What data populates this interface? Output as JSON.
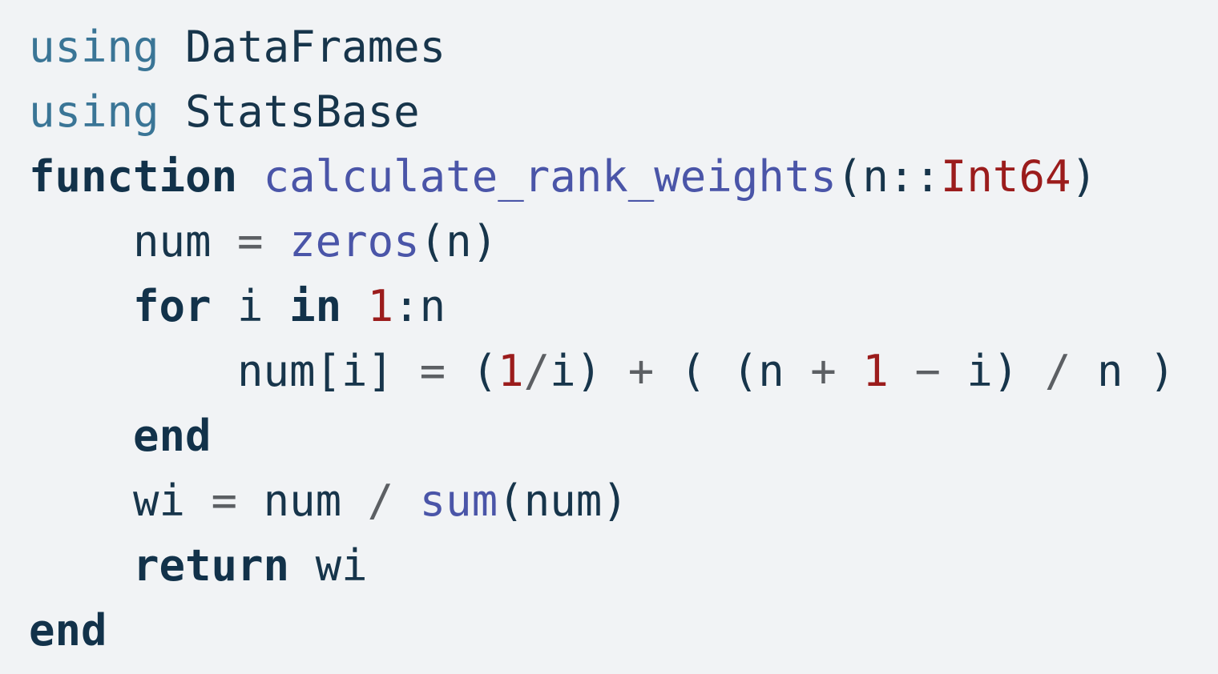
{
  "code": {
    "lines": [
      {
        "tokens": [
          {
            "t": "using",
            "c": "kw-light"
          },
          {
            "t": " "
          },
          {
            "t": "DataFrames"
          }
        ]
      },
      {
        "tokens": [
          {
            "t": "using",
            "c": "kw-light"
          },
          {
            "t": " "
          },
          {
            "t": "StatsBase"
          }
        ]
      },
      {
        "tokens": [
          {
            "t": "function",
            "c": "kw"
          },
          {
            "t": " "
          },
          {
            "t": "calculate_rank_weights",
            "c": "fn"
          },
          {
            "t": "(n::"
          },
          {
            "t": "Int64",
            "c": "type"
          },
          {
            "t": ")"
          }
        ]
      },
      {
        "indent": 1,
        "tokens": [
          {
            "t": "num "
          },
          {
            "t": "=",
            "c": "op"
          },
          {
            "t": " "
          },
          {
            "t": "zeros",
            "c": "fn"
          },
          {
            "t": "(n)"
          }
        ]
      },
      {
        "indent": 1,
        "tokens": [
          {
            "t": "for",
            "c": "kw"
          },
          {
            "t": " i "
          },
          {
            "t": "in",
            "c": "kw"
          },
          {
            "t": " "
          },
          {
            "t": "1",
            "c": "num"
          },
          {
            "t": ":n"
          }
        ]
      },
      {
        "indent": 2,
        "tokens": [
          {
            "t": "num[i] "
          },
          {
            "t": "=",
            "c": "op"
          },
          {
            "t": " ("
          },
          {
            "t": "1",
            "c": "num"
          },
          {
            "t": "/",
            "c": "op"
          },
          {
            "t": "i) "
          },
          {
            "t": "+",
            "c": "op"
          },
          {
            "t": " ( (n "
          },
          {
            "t": "+",
            "c": "op"
          },
          {
            "t": " "
          },
          {
            "t": "1",
            "c": "num"
          },
          {
            "t": " "
          },
          {
            "t": "−",
            "c": "op"
          },
          {
            "t": " i) "
          },
          {
            "t": "/",
            "c": "op"
          },
          {
            "t": " n )"
          }
        ]
      },
      {
        "indent": 1,
        "tokens": [
          {
            "t": "end",
            "c": "kw"
          }
        ]
      },
      {
        "indent": 1,
        "tokens": [
          {
            "t": "wi "
          },
          {
            "t": "=",
            "c": "op"
          },
          {
            "t": " num "
          },
          {
            "t": "/",
            "c": "op"
          },
          {
            "t": " "
          },
          {
            "t": "sum",
            "c": "fn"
          },
          {
            "t": "(num)"
          }
        ]
      },
      {
        "indent": 1,
        "tokens": [
          {
            "t": "return",
            "c": "kw"
          },
          {
            "t": " wi"
          }
        ]
      },
      {
        "tokens": [
          {
            "t": "end",
            "c": "kw"
          }
        ]
      }
    ]
  },
  "colors": {
    "background": "#f1f3f5",
    "text": "#17354b",
    "keyword": "#12324a",
    "import_keyword": "#3a7596",
    "function_name": "#4a55a8",
    "number": "#9b1c1c",
    "type": "#9b1c1c",
    "operator": "#5c5f63"
  }
}
